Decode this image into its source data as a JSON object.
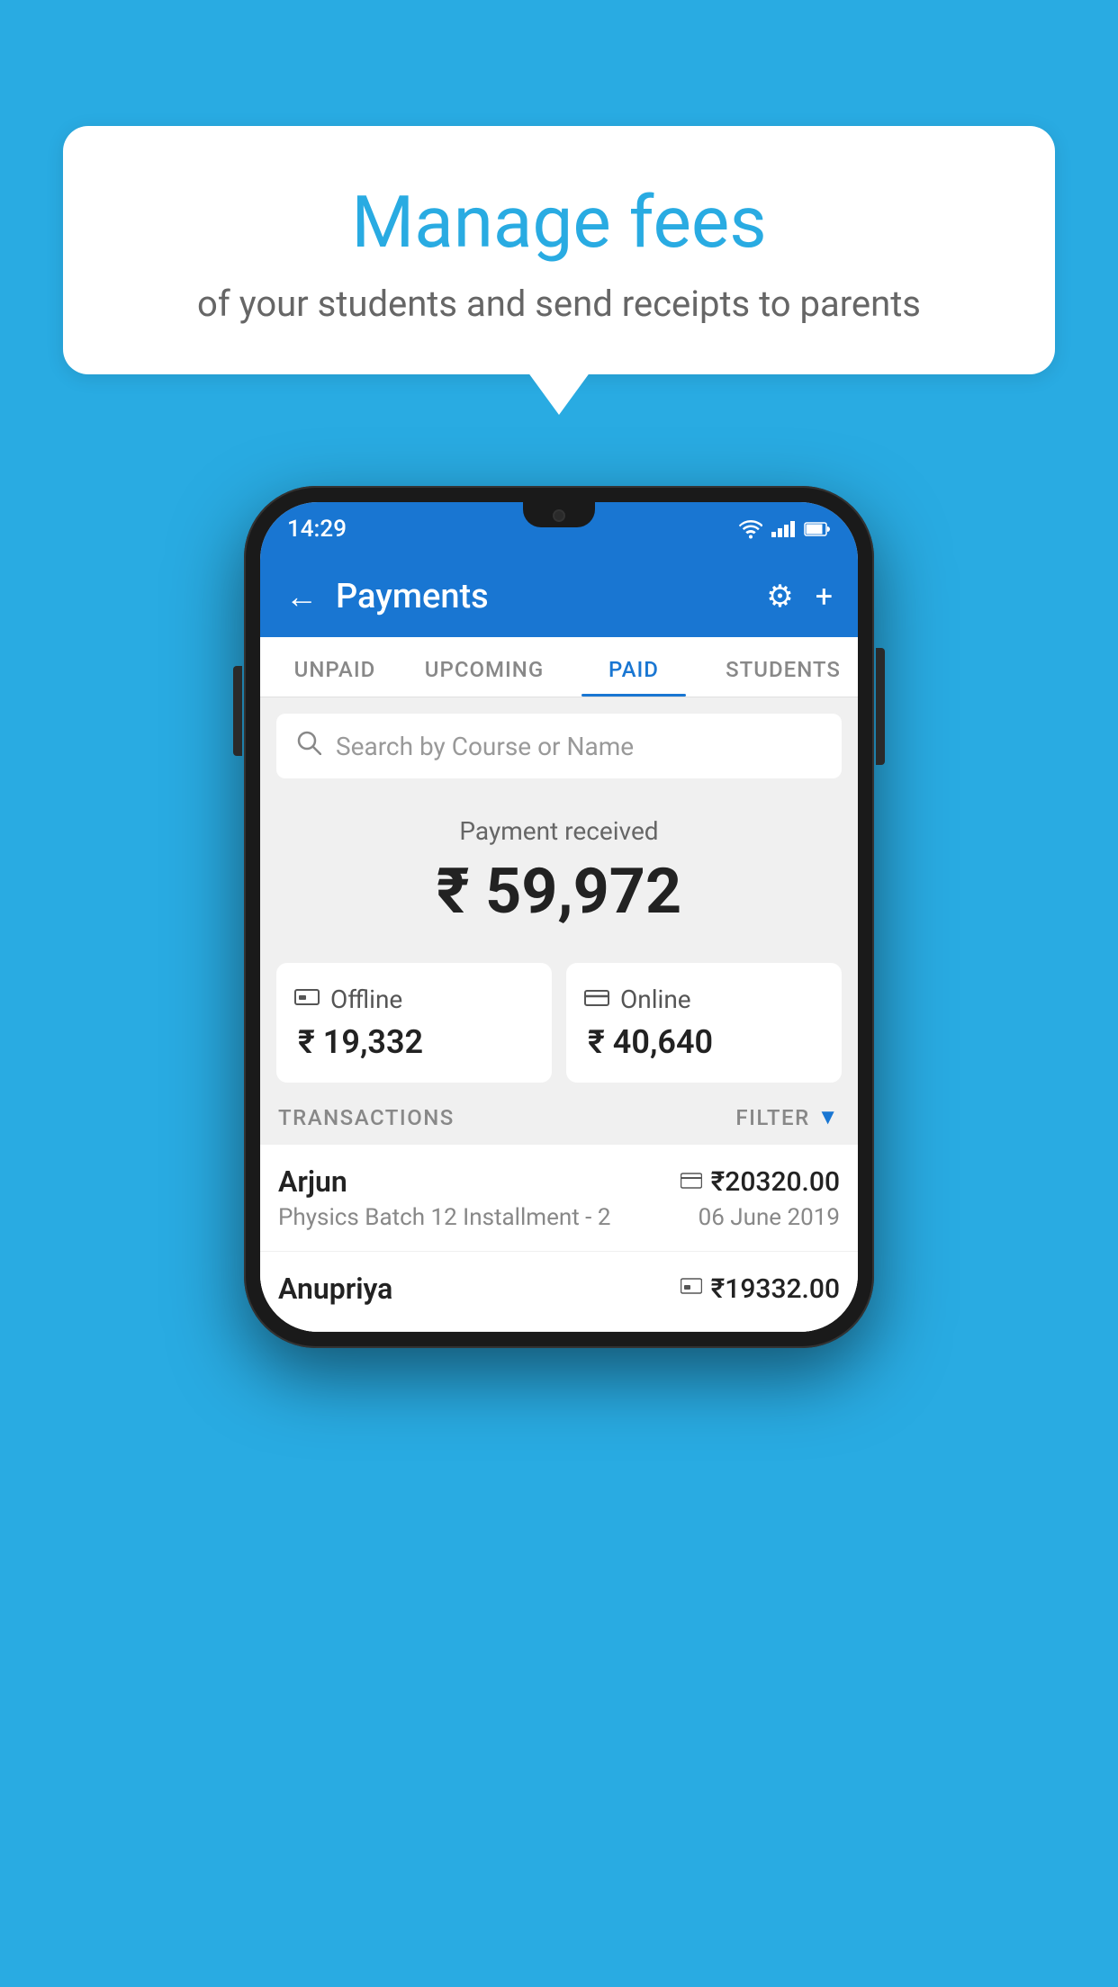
{
  "background_color": "#29ABE2",
  "speech_bubble": {
    "title": "Manage fees",
    "subtitle": "of your students and send receipts to parents"
  },
  "phone": {
    "status_bar": {
      "time": "14:29"
    },
    "top_bar": {
      "title": "Payments",
      "back_label": "←",
      "settings_label": "⚙",
      "add_label": "+"
    },
    "tabs": [
      {
        "label": "UNPAID",
        "active": false
      },
      {
        "label": "UPCOMING",
        "active": false
      },
      {
        "label": "PAID",
        "active": true
      },
      {
        "label": "STUDENTS",
        "active": false
      }
    ],
    "search": {
      "placeholder": "Search by Course or Name"
    },
    "payment_received": {
      "label": "Payment received",
      "amount": "₹ 59,972"
    },
    "payment_cards": [
      {
        "icon": "💳",
        "label": "Offline",
        "amount": "₹ 19,332"
      },
      {
        "icon": "💳",
        "label": "Online",
        "amount": "₹ 40,640"
      }
    ],
    "transactions_section": {
      "label": "TRANSACTIONS",
      "filter_label": "FILTER"
    },
    "transactions": [
      {
        "name": "Arjun",
        "detail": "Physics Batch 12 Installment - 2",
        "amount": "₹20320.00",
        "date": "06 June 2019",
        "method_icon": "💳"
      },
      {
        "name": "Anupriya",
        "detail": "",
        "amount": "₹19332.00",
        "date": "",
        "method_icon": "💳"
      }
    ]
  }
}
